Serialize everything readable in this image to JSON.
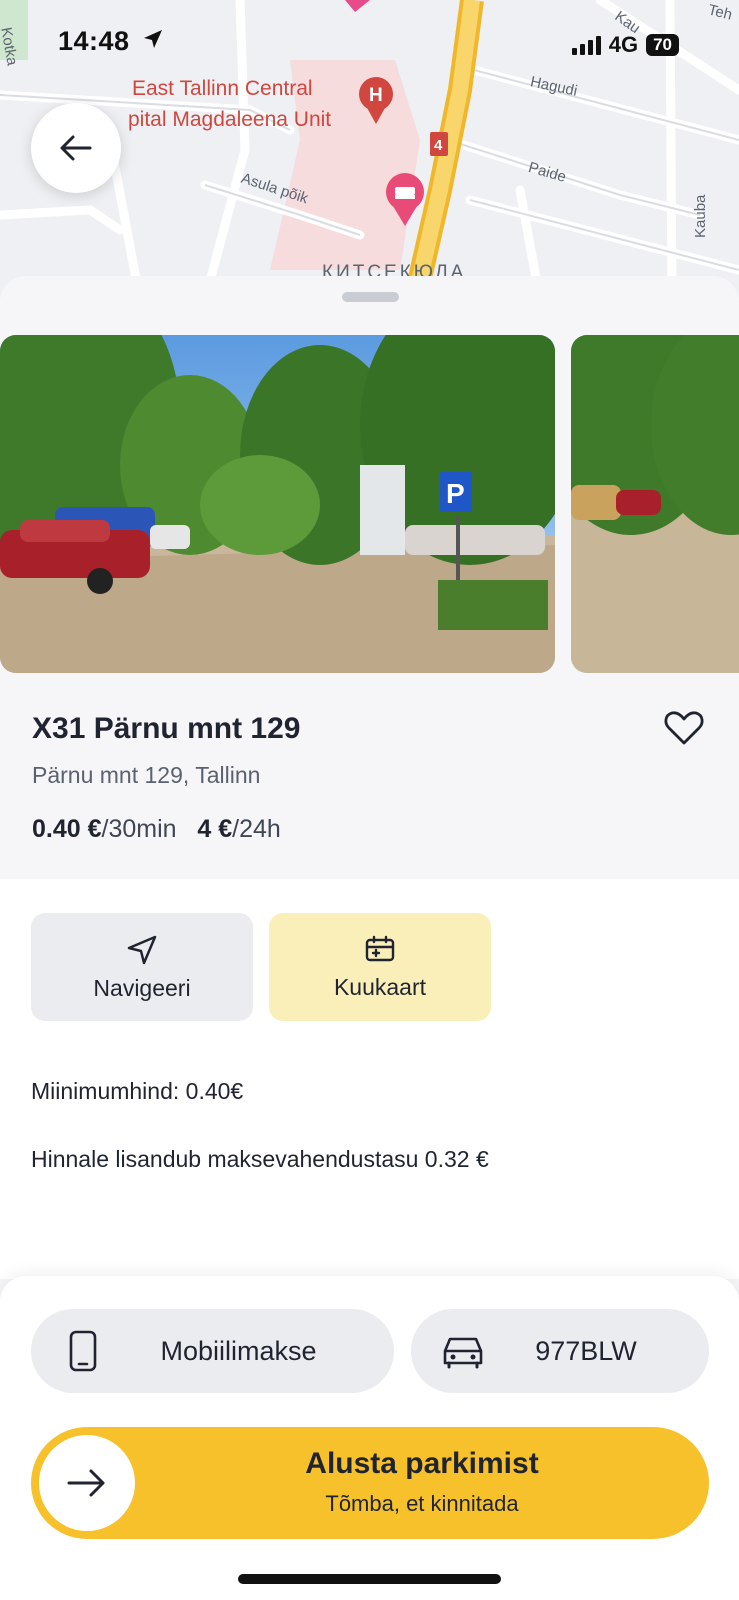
{
  "status_bar": {
    "time": "14:48",
    "network": "4G",
    "battery": "70"
  },
  "map": {
    "labels": {
      "kotka": "Kotka",
      "hagudi": "Hagudi",
      "paide": "Paide",
      "asula": "Asula põik",
      "kauba": "Kauba",
      "kauba_top": "Kau",
      "tehnika": "Teh",
      "district": "КИТСЕКЮЛА",
      "road_number": "4"
    },
    "poi": {
      "line1": "East Tallinn Central",
      "line2": "pital Magdaleena Unit"
    }
  },
  "parking": {
    "title": "X31 Pärnu mnt 129",
    "address": "Pärnu mnt 129, Tallinn",
    "price_short_value": "0.40 €",
    "price_short_unit": "/30min",
    "price_day_value": "4 €",
    "price_day_unit": "/24h",
    "sign_letter": "P"
  },
  "actions": {
    "navigate": "Navigeeri",
    "monthly": "Kuukaart"
  },
  "notes": {
    "minimum": "Miinimumhind: 0.40€",
    "fee": "Hinnale lisandub maksevahendustasu 0.32 €"
  },
  "payment": {
    "method": "Mobiilimakse",
    "plate": "977BLW"
  },
  "start": {
    "label": "Alusta parkimist",
    "sub": "Tõmba, et kinnitada"
  },
  "colors": {
    "accent": "#f7c12b",
    "accent_soft": "#fbefb9",
    "poi_red": "#d0473f",
    "road_yellow": "#f5c542"
  }
}
